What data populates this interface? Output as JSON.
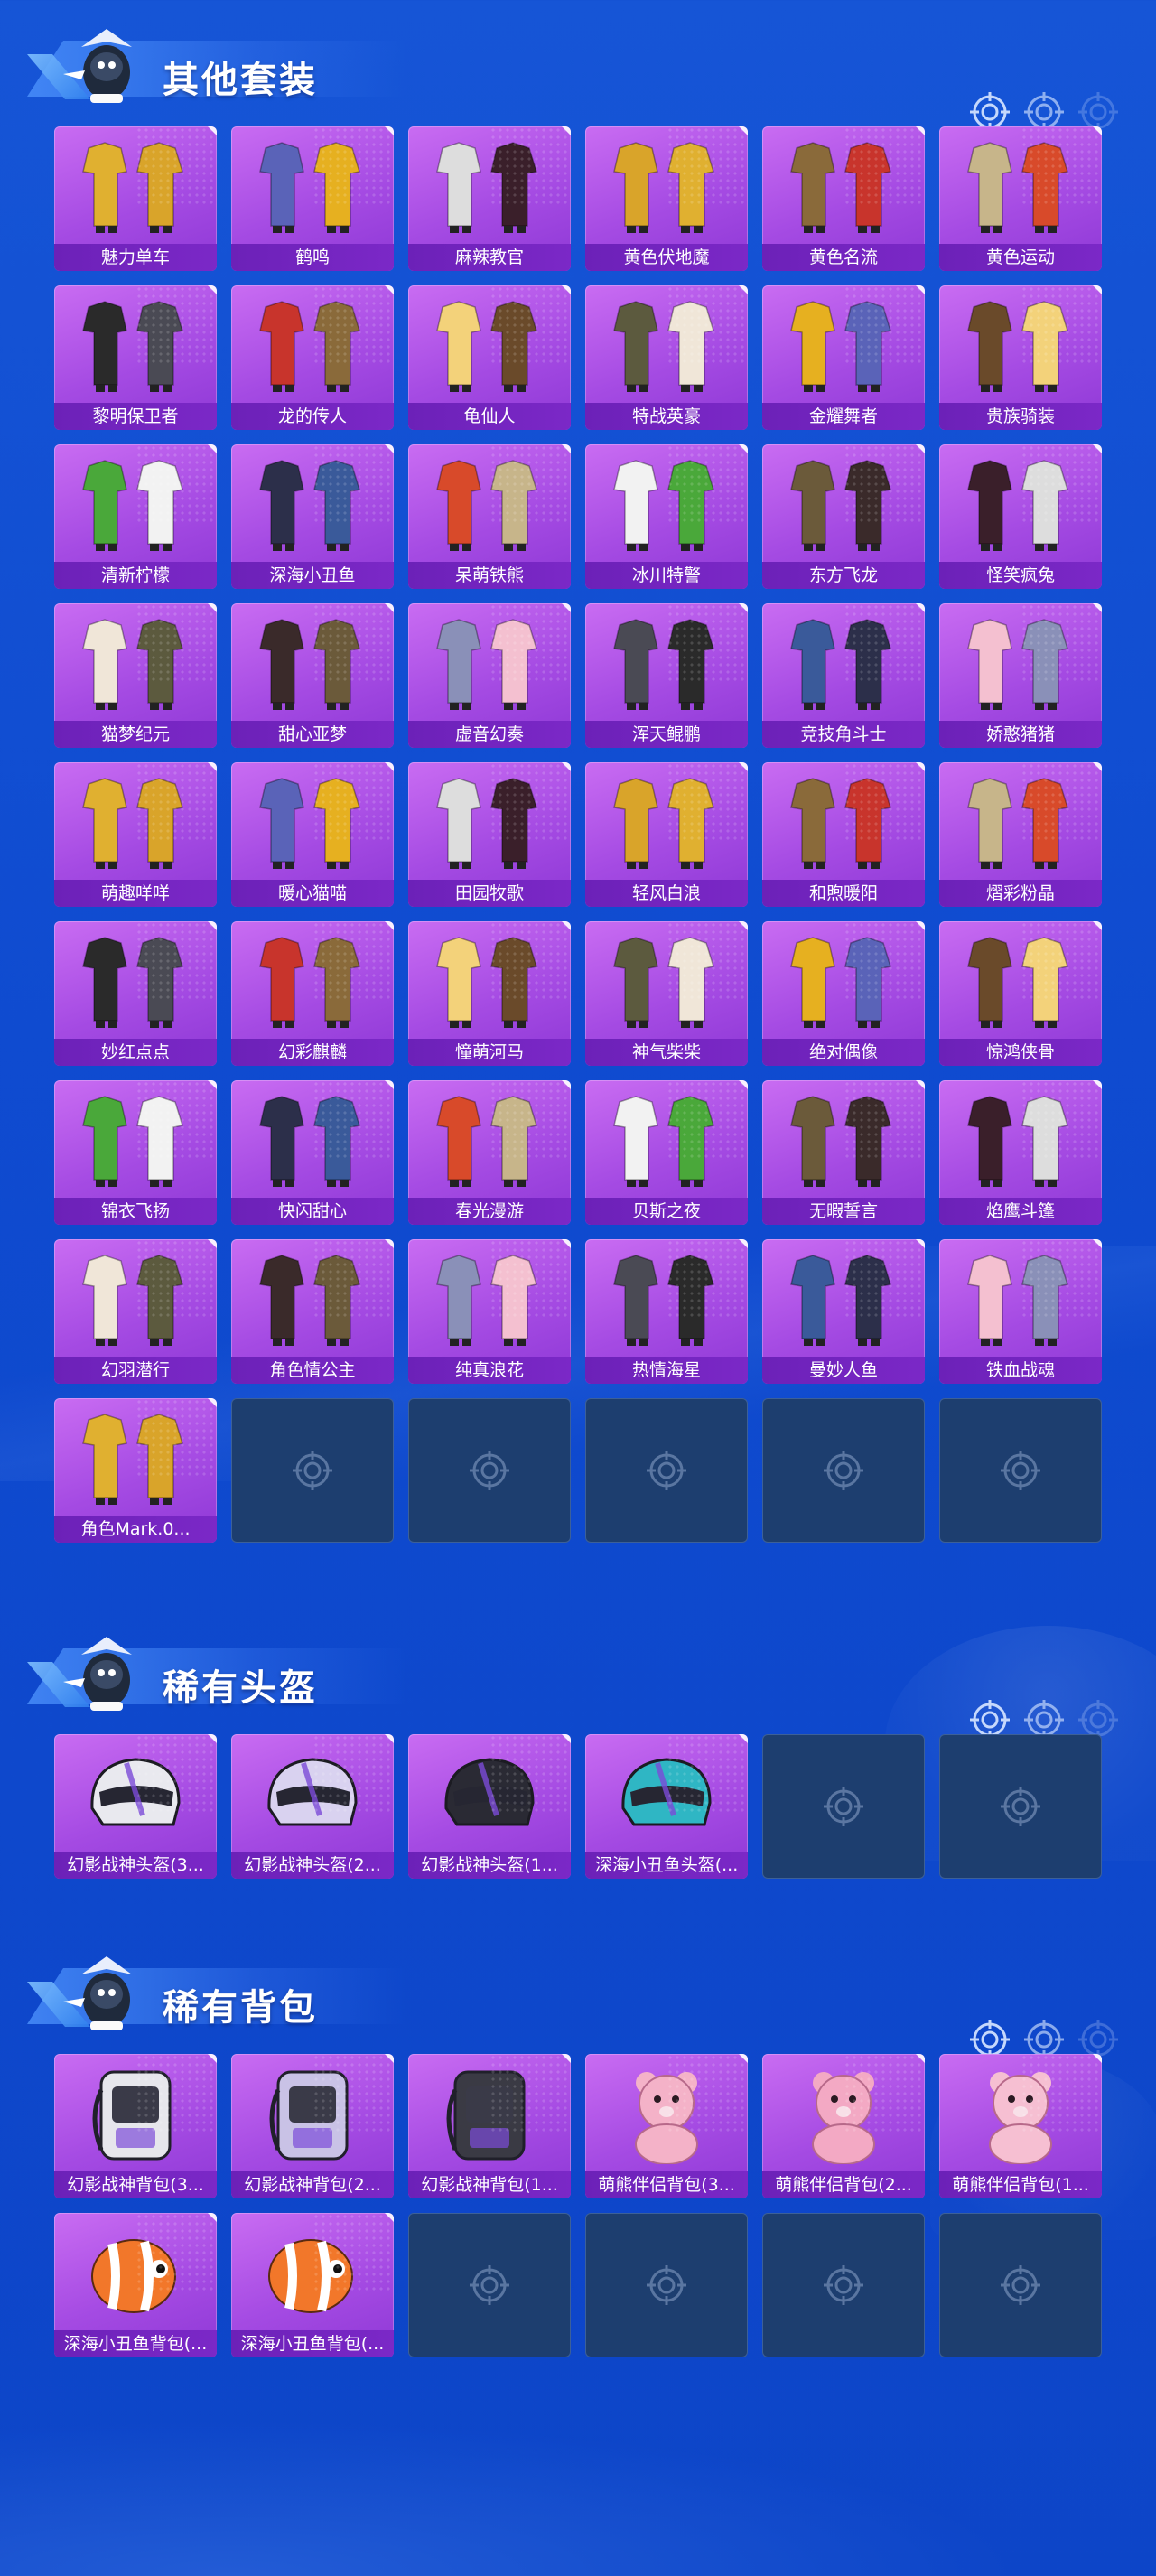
{
  "sections": {
    "outfits": {
      "title": "其他套装",
      "items": [
        {
          "label": "魅力单车",
          "icon": "outfit-icon"
        },
        {
          "label": "鹤鸣",
          "icon": "outfit-icon"
        },
        {
          "label": "麻辣教官",
          "icon": "outfit-icon"
        },
        {
          "label": "黄色伏地魔",
          "icon": "outfit-icon"
        },
        {
          "label": "黄色名流",
          "icon": "outfit-icon"
        },
        {
          "label": "黄色运动",
          "icon": "outfit-icon"
        },
        {
          "label": "黎明保卫者",
          "icon": "outfit-icon"
        },
        {
          "label": "龙的传人",
          "icon": "outfit-icon"
        },
        {
          "label": "龟仙人",
          "icon": "outfit-icon"
        },
        {
          "label": "特战英豪",
          "icon": "outfit-icon"
        },
        {
          "label": "金耀舞者",
          "icon": "outfit-icon"
        },
        {
          "label": "贵族骑装",
          "icon": "outfit-icon"
        },
        {
          "label": "清新柠檬",
          "icon": "outfit-icon"
        },
        {
          "label": "深海小丑鱼",
          "icon": "outfit-icon"
        },
        {
          "label": "呆萌铁熊",
          "icon": "outfit-icon"
        },
        {
          "label": "冰川特警",
          "icon": "outfit-icon"
        },
        {
          "label": "东方飞龙",
          "icon": "outfit-icon"
        },
        {
          "label": "怪笑疯兔",
          "icon": "outfit-icon"
        },
        {
          "label": "猫梦纪元",
          "icon": "outfit-icon"
        },
        {
          "label": "甜心亚梦",
          "icon": "outfit-icon"
        },
        {
          "label": "虚音幻奏",
          "icon": "outfit-icon"
        },
        {
          "label": "浑天鲲鹏",
          "icon": "outfit-icon"
        },
        {
          "label": "竞技角斗士",
          "icon": "outfit-icon"
        },
        {
          "label": "娇憨猪猪",
          "icon": "outfit-icon"
        },
        {
          "label": "萌趣咩咩",
          "icon": "outfit-icon"
        },
        {
          "label": "暖心猫喵",
          "icon": "outfit-icon"
        },
        {
          "label": "田园牧歌",
          "icon": "outfit-icon"
        },
        {
          "label": "轻风白浪",
          "icon": "outfit-icon"
        },
        {
          "label": "和煦暖阳",
          "icon": "outfit-icon"
        },
        {
          "label": "熠彩粉晶",
          "icon": "outfit-icon"
        },
        {
          "label": "妙红点点",
          "icon": "outfit-icon"
        },
        {
          "label": "幻彩麒麟",
          "icon": "outfit-icon"
        },
        {
          "label": "憧萌河马",
          "icon": "outfit-icon"
        },
        {
          "label": "神气柴柴",
          "icon": "outfit-icon"
        },
        {
          "label": "绝对偶像",
          "icon": "outfit-icon"
        },
        {
          "label": "惊鸿侠骨",
          "icon": "outfit-icon"
        },
        {
          "label": "锦衣飞扬",
          "icon": "outfit-icon"
        },
        {
          "label": "快闪甜心",
          "icon": "outfit-icon"
        },
        {
          "label": "春光漫游",
          "icon": "outfit-icon"
        },
        {
          "label": "贝斯之夜",
          "icon": "outfit-icon"
        },
        {
          "label": "无暇誓言",
          "icon": "outfit-icon"
        },
        {
          "label": "焰鹰斗篷",
          "icon": "outfit-icon"
        },
        {
          "label": "幻羽潜行",
          "icon": "outfit-icon"
        },
        {
          "label": "角色情公主",
          "icon": "outfit-icon"
        },
        {
          "label": "纯真浪花",
          "icon": "outfit-icon"
        },
        {
          "label": "热情海星",
          "icon": "outfit-icon"
        },
        {
          "label": "曼妙人鱼",
          "icon": "outfit-icon"
        },
        {
          "label": "铁血战魂",
          "icon": "outfit-icon"
        },
        {
          "label": "角色Mark.0...",
          "icon": "outfit-icon"
        }
      ],
      "empty_slots": 5
    },
    "helmets": {
      "title": "稀有头盔",
      "items": [
        {
          "label": "幻影战神头盔(3...",
          "icon": "helmet-icon",
          "accent": "#e9e9ef"
        },
        {
          "label": "幻影战神头盔(2...",
          "icon": "helmet-icon",
          "accent": "#d9d2f0"
        },
        {
          "label": "幻影战神头盔(1...",
          "icon": "helmet-icon",
          "accent": "#2a2a34"
        },
        {
          "label": "深海小丑鱼头盔(...",
          "icon": "helmet-icon",
          "accent": "#2fb6c4"
        }
      ],
      "empty_slots": 2
    },
    "backpacks": {
      "title": "稀有背包",
      "items": [
        {
          "label": "幻影战神背包(3...",
          "icon": "backpack-icon",
          "accent": "#e6e6ec"
        },
        {
          "label": "幻影战神背包(2...",
          "icon": "backpack-icon",
          "accent": "#c9c2e6"
        },
        {
          "label": "幻影战神背包(1...",
          "icon": "backpack-icon",
          "accent": "#3a3a44"
        },
        {
          "label": "萌熊伴侣背包(3...",
          "icon": "bear-backpack-icon",
          "accent": "#f4b2c8"
        },
        {
          "label": "萌熊伴侣背包(2...",
          "icon": "bear-backpack-icon",
          "accent": "#f3a9c4"
        },
        {
          "label": "萌熊伴侣背包(1...",
          "icon": "bear-backpack-icon",
          "accent": "#f6bfd2"
        },
        {
          "label": "深海小丑鱼背包(...",
          "icon": "clownfish-backpack-icon",
          "accent": "#f2772a"
        },
        {
          "label": "深海小丑鱼背包(...",
          "icon": "clownfish-backpack-icon",
          "accent": "#f2772a"
        }
      ],
      "empty_slots": 4
    }
  },
  "colors": {
    "background": "#1050d2",
    "card_purple": "#a54be3",
    "label_bar": "#6c21b8",
    "empty_slot": "#1d3e6f"
  }
}
